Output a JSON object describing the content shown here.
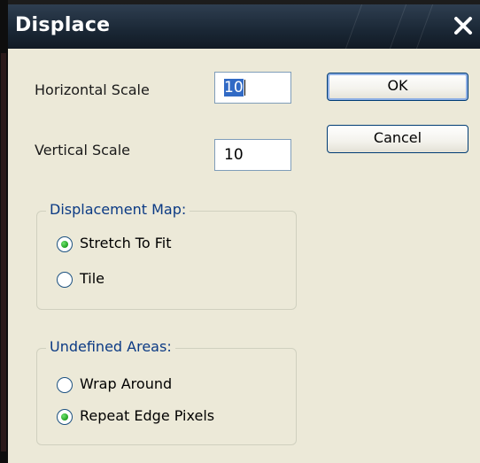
{
  "window": {
    "title": "Displace"
  },
  "fields": {
    "horizontal_label": "Horizontal Scale",
    "horizontal_value": "10",
    "vertical_label": "Vertical Scale",
    "vertical_value": "10"
  },
  "buttons": {
    "ok": "OK",
    "cancel": "Cancel"
  },
  "displacement_map": {
    "label": "Displacement Map:",
    "options": [
      {
        "label": "Stretch To Fit",
        "selected": true
      },
      {
        "label": "Tile",
        "selected": false
      }
    ]
  },
  "undefined_areas": {
    "label": "Undefined Areas:",
    "options": [
      {
        "label": "Wrap Around",
        "selected": false
      },
      {
        "label": "Repeat Edge Pixels",
        "selected": true
      }
    ]
  },
  "colors": {
    "titlebar": "#1a2735",
    "dialog_bg": "#ece9d8",
    "group_label": "#0b3a84",
    "radio_dot": "#21a121"
  },
  "icons": {
    "close": "close-icon"
  }
}
